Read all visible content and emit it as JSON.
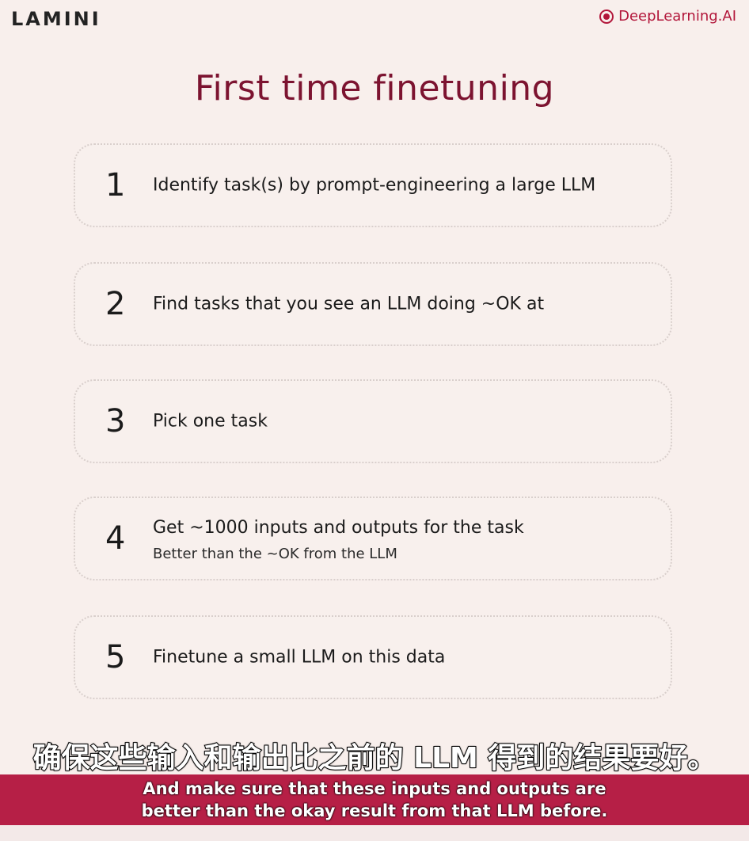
{
  "header": {
    "logo_text": "LAMINI",
    "brand_text": "DeepLearning.AI",
    "brand_icon": "deeplearning-ai-logo-icon",
    "brand_color": "#b2163a"
  },
  "main": {
    "title": "First time finetuning",
    "title_color": "#7c1330",
    "steps": [
      {
        "number": "1",
        "text": "Identify task(s) by prompt-engineering a large LLM"
      },
      {
        "number": "2",
        "text": "Find tasks that you see an LLM doing ~OK at"
      },
      {
        "number": "3",
        "text": "Pick one task"
      },
      {
        "number": "4",
        "text": "Get ~1000 inputs and outputs for the task",
        "subtext": "Better than the ~OK from the LLM"
      },
      {
        "number": "5",
        "text": "Finetune a small LLM on this data"
      }
    ]
  },
  "subtitles": {
    "chinese": "确保这些输入和输出比之前的 LLM 得到的结果要好。",
    "english_line1": "And make sure that these inputs and outputs are",
    "english_line2": "better than the okay result from that LLM before.",
    "bar_color": "#b61f46"
  }
}
